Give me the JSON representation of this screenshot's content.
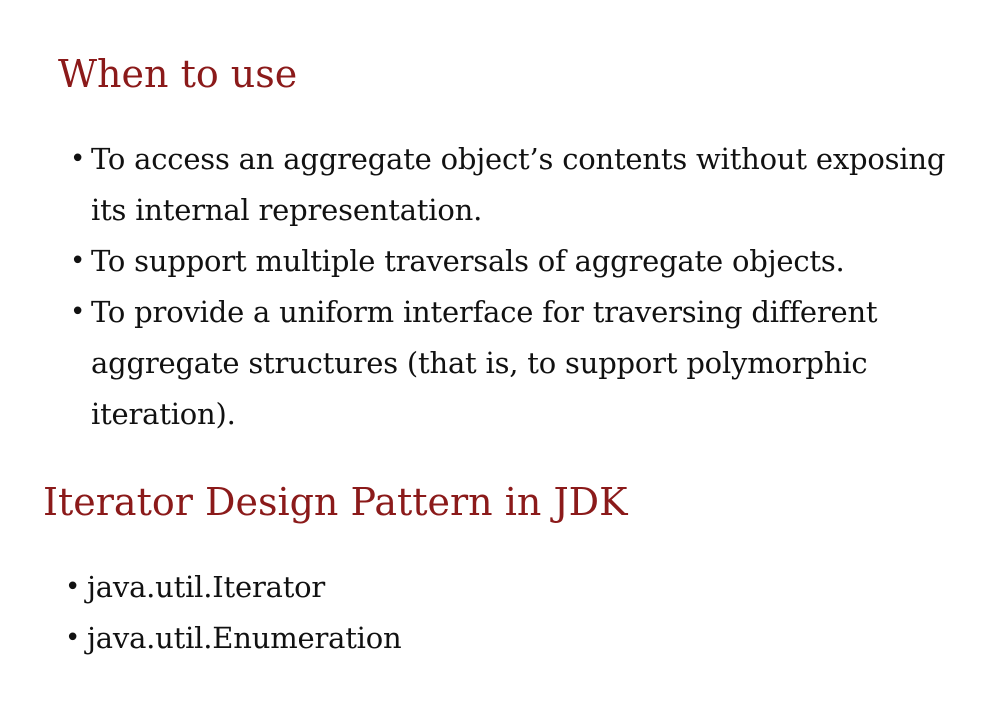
{
  "when_to_use": {
    "title": "When to use",
    "items": [
      "To access an aggregate object’s contents without exposing its internal representation.",
      "To support multiple traversals of aggregate objects.",
      "To provide a uniform interface for traversing different aggregate structures (that is, to support polymorphic iteration)."
    ]
  },
  "jdk": {
    "title": "Iterator Design Pattern in JDK",
    "items": [
      "java.util.Iterator",
      "java.util.Enumeration"
    ]
  },
  "bullet_glyph": "•",
  "colors": {
    "heading": "#8b1a1a",
    "text": "#111111",
    "background": "#ffffff"
  }
}
